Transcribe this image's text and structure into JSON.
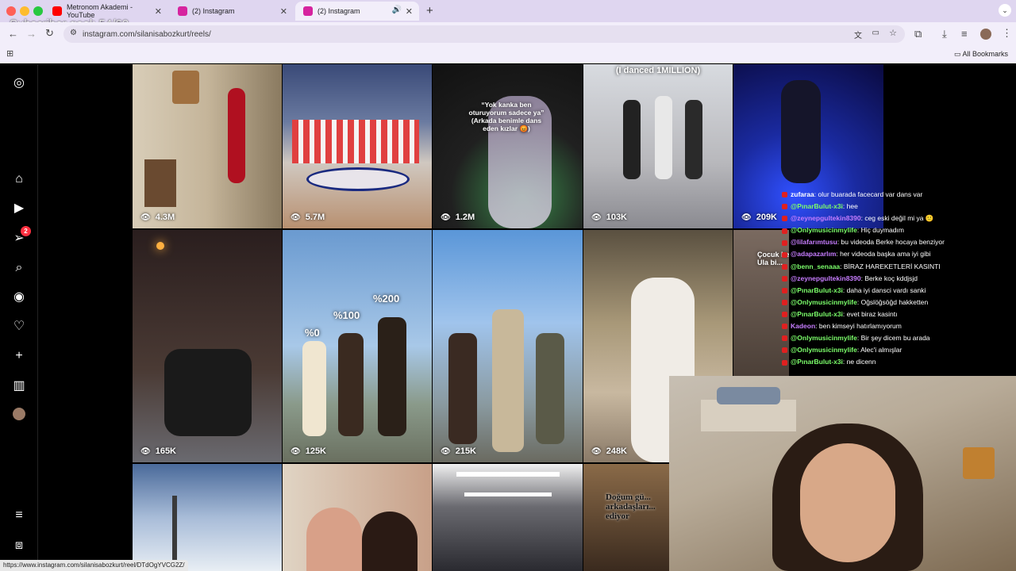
{
  "browser": {
    "tabs": [
      {
        "title": "Metronom Akademi - YouTube",
        "color": "#ff0000"
      },
      {
        "title": "(2) Instagram",
        "color": "#d6249f"
      },
      {
        "title": "(2) Instagram",
        "color": "#d6249f"
      }
    ],
    "url": "instagram.com/silanisabozkurt/reels/",
    "bookmarks_label": "All Bookmarks",
    "status_url": "https://www.instagram.com/silanisabozkurt/reel/DTdOgYVCG2Z/"
  },
  "overlay": {
    "goal": "Subscriber goal: 54/60"
  },
  "sidebar": {
    "notification_count": "2"
  },
  "reels": [
    {
      "views": "4.3M",
      "bg": "#b9aa92"
    },
    {
      "views": "5.7M",
      "bg": "#5e6f8f"
    },
    {
      "views": "1.2M",
      "bg": "#2a2230",
      "caption": "“Yok kanka ben oturuyorum sadece ya” (Arkada benimle dans eden kızlar 😡)"
    },
    {
      "views": "103K",
      "bg": "#9a9aa0",
      "caption": "(I danced 1MILLION)"
    },
    {
      "views": "209K",
      "bg": "#1a2e9a"
    },
    {
      "views": "165K",
      "bg": "#3a2a26"
    },
    {
      "views": "125K",
      "bg": "#7fb0dc",
      "labels": [
        "%0",
        "%100",
        "%200"
      ]
    },
    {
      "views": "215K",
      "bg": "#6fa3d8"
    },
    {
      "views": "248K",
      "bg": "#8a7a62"
    },
    {
      "views": "",
      "bg": "#6a5e55",
      "caption": "Çocuk beni üzecekmiş... Ula bi..."
    },
    {
      "views": "",
      "bg": "#9db4d8"
    },
    {
      "views": "",
      "bg": "#c9a88a"
    },
    {
      "views": "",
      "bg": "#3a3a44"
    },
    {
      "views": "",
      "bg": "#4a3c2e",
      "caption": "Doğum gü... arkadaşları... ediyor"
    }
  ],
  "chat": [
    {
      "user": "zufaraa",
      "msg": ": olur buarada facecard var dans var",
      "color": "#ffffff"
    },
    {
      "user": "@PınarBulut-x3i",
      "msg": ": hee",
      "color": "#7cff6b"
    },
    {
      "user": "@zeynepgultekin8390",
      "msg": ": ceg eski değil mi ya 🙂",
      "color": "#c77dff"
    },
    {
      "user": "@Onlymusicinmylife",
      "msg": ": Hiç duymadım",
      "color": "#7cff6b"
    },
    {
      "user": "@lilafarımtusu",
      "msg": ": bu videoda Berke hocaya benziyor",
      "color": "#c77dff"
    },
    {
      "user": "@adapazarlım",
      "msg": ": her videoda başka ama iyi gibi",
      "color": "#c77dff"
    },
    {
      "user": "@benn_senaaa",
      "msg": ": BİRAZ HAREKETLERİ KASINTI",
      "color": "#7cff6b"
    },
    {
      "user": "@zeynepgultekin8390",
      "msg": ": Berke koç kddjsjd",
      "color": "#c77dff"
    },
    {
      "user": "@PınarBulut-x3i",
      "msg": ": daha iyi dansci vardı sanki",
      "color": "#7cff6b"
    },
    {
      "user": "@Onlymusicinmylife",
      "msg": ": Oğslöğsöğd hakketten",
      "color": "#7cff6b"
    },
    {
      "user": "@PınarBulut-x3i",
      "msg": ": evet biraz kasintı",
      "color": "#7cff6b"
    },
    {
      "user": "Kadeon",
      "msg": ": ben kimseyi hatırlamıyorum",
      "color": "#c77dff"
    },
    {
      "user": "@Onlymusicinmylife",
      "msg": ": Bir şey dicem bu arada",
      "color": "#7cff6b"
    },
    {
      "user": "@Onlymusicinmylife",
      "msg": ": Alec'i almışlar",
      "color": "#7cff6b"
    },
    {
      "user": "@PınarBulut-x3i",
      "msg": ": ne dicenn",
      "color": "#7cff6b"
    }
  ]
}
